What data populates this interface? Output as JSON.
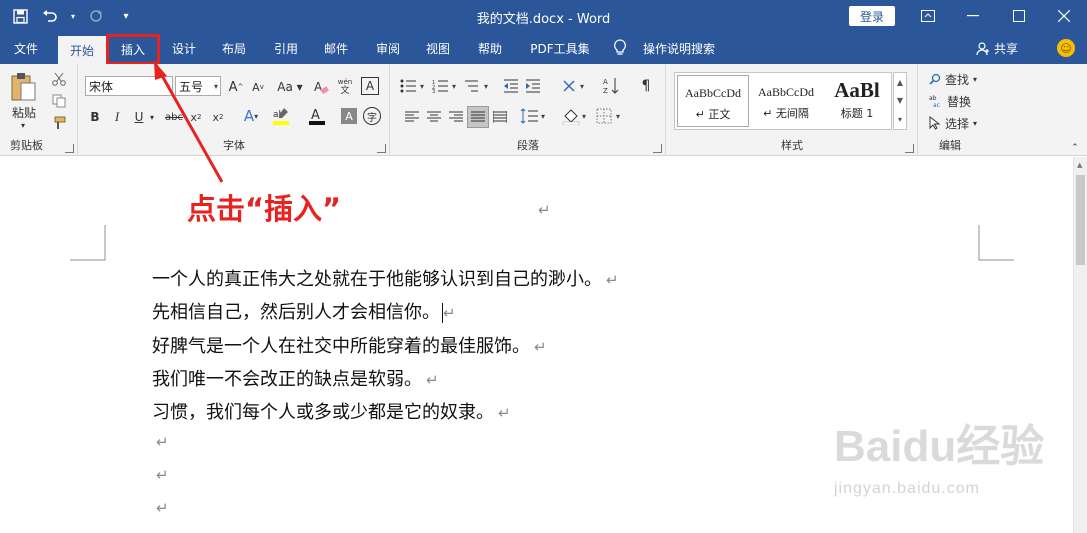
{
  "window": {
    "title": "我的文档.docx  -  Word",
    "login_label": "登录"
  },
  "tabs": [
    "文件",
    "开始",
    "插入",
    "设计",
    "布局",
    "引用",
    "邮件",
    "审阅",
    "视图",
    "帮助",
    "PDF工具集"
  ],
  "active_tab": "开始",
  "highlighted_tab": "插入",
  "tell_me": "操作说明搜索",
  "share_label": "共享",
  "ribbon": {
    "clipboard": {
      "paste_label": "粘贴",
      "group_label": "剪贴板"
    },
    "font": {
      "font_name": "宋体",
      "font_size": "五号",
      "bold": "B",
      "italic": "I",
      "underline": "U",
      "group_label": "字体"
    },
    "paragraph": {
      "group_label": "段落"
    },
    "styles": {
      "items": [
        {
          "preview": "AaBbCcDd",
          "name": "↵ 正文"
        },
        {
          "preview": "AaBbCcDd",
          "name": "↵ 无间隔"
        },
        {
          "preview": "AaBl",
          "name": "标题 1"
        }
      ],
      "group_label": "样式"
    },
    "editing": {
      "find": "查找",
      "replace": "替换",
      "select": "选择",
      "group_label": "编辑"
    }
  },
  "document": {
    "lines": [
      "一个人的真正伟大之处就在于他能够认识到自己的渺小。",
      "先相信自己，然后别人才会相信你。",
      "好脾气是一个人在社交中所能穿着的最佳服饰。",
      "我们唯一不会改正的缺点是软弱。",
      "习惯，我们每个人或多或少都是它的奴隶。"
    ],
    "paragraph_mark": "↵"
  },
  "annotation": "点击“插入”",
  "watermark": {
    "brand": "Baidu经验",
    "url": "jingyan.baidu.com"
  },
  "colors": {
    "title_bar": "#2b579a",
    "ribbon_bg": "#f3f3f3",
    "annotation_red": "#e8231f"
  }
}
